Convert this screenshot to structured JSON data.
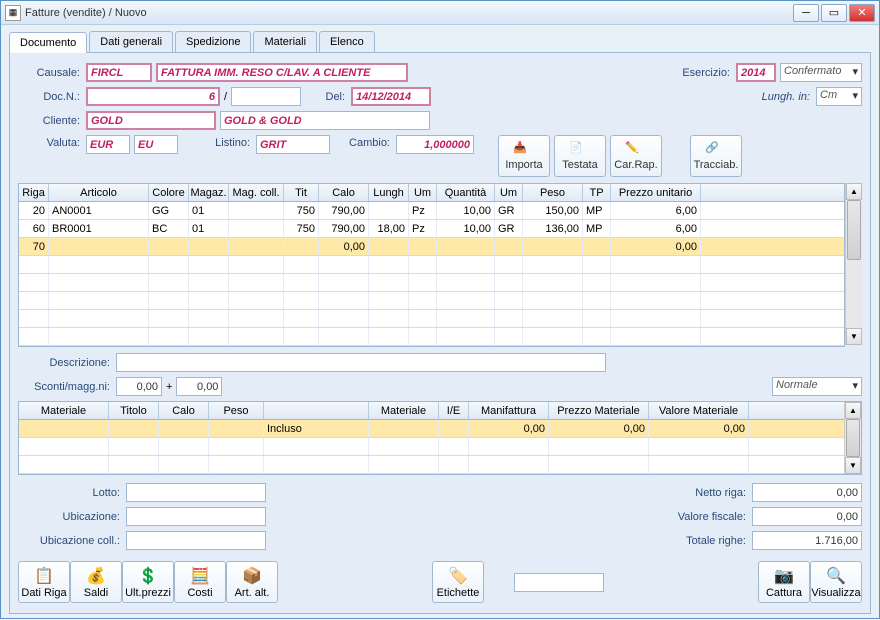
{
  "window": {
    "title": "Fatture (vendite) / Nuovo"
  },
  "tabs": [
    "Documento",
    "Dati generali",
    "Spedizione",
    "Materiali",
    "Elenco"
  ],
  "header": {
    "causale_label": "Causale:",
    "causale_code": "FIRCL",
    "causale_desc": "FATTURA IMM. RESO C/LAV. A CLIENTE",
    "esercizio_label": "Esercizio:",
    "esercizio_val": "2014",
    "esercizio_state": "Confermato",
    "docn_label": "Doc.N.:",
    "docn_val": "6",
    "docn_sep": "/",
    "del_label": "Del:",
    "del_val": "14/12/2014",
    "lungh_label": "Lungh. in:",
    "lungh_val": "Cm",
    "cliente_label": "Cliente:",
    "cliente_code": "GOLD",
    "cliente_desc": "GOLD & GOLD",
    "valuta_label": "Valuta:",
    "valuta_code": "EUR",
    "valuta_sym": "EU",
    "listino_label": "Listino:",
    "listino_val": "GRIT",
    "cambio_label": "Cambio:",
    "cambio_val": "1,000000",
    "btn_importa": "Importa",
    "btn_testata": "Testata",
    "btn_carrap": "Car.Rap.",
    "btn_tracciab": "Tracciab."
  },
  "grid1": {
    "headers": [
      "Riga",
      "Articolo",
      "Colore",
      "Magaz.",
      "Mag. coll.",
      "Tit",
      "Calo",
      "Lungh",
      "Um",
      "Quantità",
      "Um",
      "Peso",
      "TP",
      "Prezzo unitario"
    ],
    "widths": [
      30,
      100,
      40,
      40,
      55,
      35,
      50,
      40,
      28,
      58,
      28,
      60,
      28,
      90
    ],
    "rows": [
      {
        "riga": "20",
        "art": "AN0001",
        "col": "GG",
        "mag": "01",
        "magc": "",
        "tit": "750",
        "calo": "790,00",
        "lungh": "",
        "um": "Pz",
        "qta": "10,00",
        "um2": "GR",
        "peso": "150,00",
        "tp": "MP",
        "prezzo": "6,00"
      },
      {
        "riga": "60",
        "art": "BR0001",
        "col": "BC",
        "mag": "01",
        "magc": "",
        "tit": "750",
        "calo": "790,00",
        "lungh": "18,00",
        "um": "Pz",
        "qta": "10,00",
        "um2": "GR",
        "peso": "136,00",
        "tp": "MP",
        "prezzo": "6,00"
      },
      {
        "riga": "70",
        "art": "",
        "col": "",
        "mag": "",
        "magc": "",
        "tit": "",
        "calo": "0,00",
        "lungh": "",
        "um": "",
        "qta": "",
        "um2": "",
        "peso": "",
        "tp": "",
        "prezzo": "0,00",
        "sel": true
      }
    ]
  },
  "mid": {
    "descrizione_label": "Descrizione:",
    "sconti_label": "Sconti/magg.ni:",
    "sconto1": "0,00",
    "sconto_plus": "+",
    "sconto2": "0,00",
    "normale": "Normale"
  },
  "grid2": {
    "headers": [
      "Materiale",
      "Titolo",
      "Calo",
      "Peso",
      "",
      "Materiale",
      "I/E",
      "Manifattura",
      "Prezzo Materiale",
      "Valore Materiale"
    ],
    "widths": [
      90,
      50,
      50,
      55,
      105,
      70,
      30,
      80,
      100,
      100
    ],
    "rows": [
      {
        "incluso": "Incluso",
        "manif": "0,00",
        "prezzo": "0,00",
        "valore": "0,00",
        "sel": true
      }
    ]
  },
  "lower": {
    "lotto_label": "Lotto:",
    "ubicazione_label": "Ubicazione:",
    "ubicazione_coll_label": "Ubicazione coll.:",
    "netto_label": "Netto riga:",
    "netto_val": "0,00",
    "valfisc_label": "Valore fiscale:",
    "valfisc_val": "0,00",
    "totrighe_label": "Totale righe:",
    "totrighe_val": "1.716,00"
  },
  "bottom_buttons": {
    "datiriga": "Dati Riga",
    "saldi": "Saldi",
    "ultprezzi": "Ult.prezzi",
    "costi": "Costi",
    "artalt": "Art. alt.",
    "etichette": "Etichette",
    "cattura": "Cattura",
    "visualizza": "Visualizza"
  }
}
